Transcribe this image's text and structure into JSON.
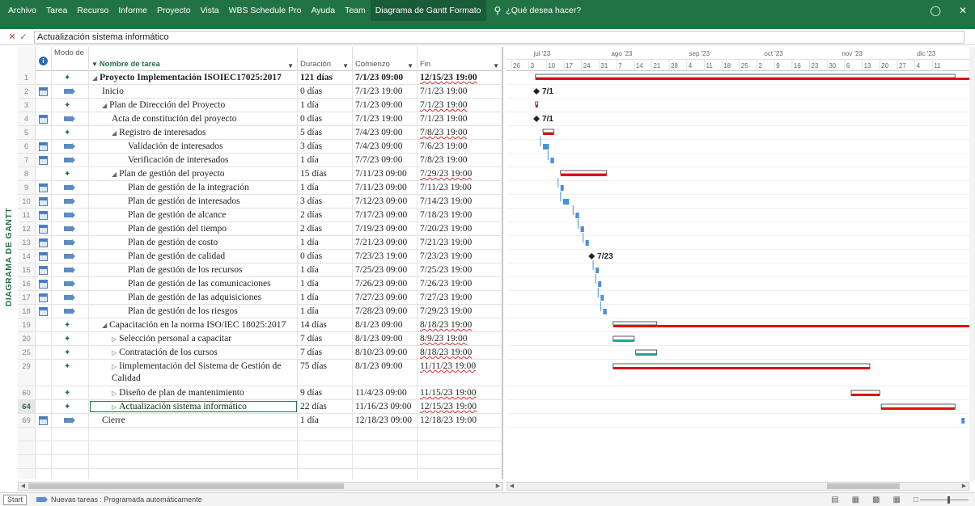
{
  "ribbon": {
    "menu": [
      "Archivo",
      "Tarea",
      "Recurso",
      "Informe",
      "Proyecto",
      "Vista",
      "WBS Schedule Pro",
      "Ayuda",
      "Team",
      "Diagrama de Gantt Formato"
    ],
    "active_index": 9,
    "help": "¿Qué desea hacer?"
  },
  "entry_bar": {
    "value": "Actualización sistema informático"
  },
  "view_label": "DIAGRAMA DE GANTT",
  "columns": {
    "mode": "Modo de",
    "name": "Nombre de tarea",
    "duration": "Duración",
    "start": "Comienzo",
    "finish": "Fin"
  },
  "timeline": {
    "months": [
      "jul '23",
      "ago '23",
      "sep '23",
      "oct '23",
      "nov '23",
      "dic '23"
    ],
    "days": [
      "26",
      "3",
      "10",
      "17",
      "24",
      "31",
      "7",
      "14",
      "21",
      "28",
      "4",
      "11",
      "18",
      "25",
      "2",
      "9",
      "16",
      "23",
      "30",
      "6",
      "13",
      "20",
      "27",
      "4",
      "11"
    ]
  },
  "milestone_labels": [
    "7/1",
    "7/1",
    "7/23"
  ],
  "tasks": [
    {
      "id": "1",
      "mode": "manual",
      "name": "Proyecto Implementación ISOIEC17025:2017",
      "duration": "121 días",
      "start": "7/1/23 09:00",
      "finish": "12/15/23 19:00",
      "summary": true,
      "level": 0,
      "bold": true
    },
    {
      "id": "2",
      "mode": "auto",
      "name": "Inicio",
      "duration": "0 días",
      "start": "7/1/23 19:00",
      "finish": "7/1/23 19:00",
      "level": 1
    },
    {
      "id": "3",
      "mode": "manual",
      "name": "Plan de Dirección del Proyecto",
      "duration": "1 día",
      "start": "7/1/23 09:00",
      "finish": "7/1/23 19:00",
      "summary": true,
      "level": 1
    },
    {
      "id": "4",
      "mode": "auto",
      "name": "Acta de constitución del proyecto",
      "duration": "0 días",
      "start": "7/1/23 19:00",
      "finish": "7/1/23 19:00",
      "level": 2
    },
    {
      "id": "5",
      "mode": "manual",
      "name": "Registro de interesados",
      "duration": "5 días",
      "start": "7/4/23 09:00",
      "finish": "7/8/23 19:00",
      "summary": true,
      "level": 2
    },
    {
      "id": "6",
      "mode": "auto",
      "name": "Validación de interesados",
      "duration": "3 días",
      "start": "7/4/23 09:00",
      "finish": "7/6/23 19:00",
      "level": 3
    },
    {
      "id": "7",
      "mode": "auto",
      "name": "Verificación de interesados",
      "duration": "1 día",
      "start": "7/7/23 09:00",
      "finish": "7/8/23 19:00",
      "level": 3
    },
    {
      "id": "8",
      "mode": "manual",
      "name": "Plan de gestión del proyecto",
      "duration": "15 días",
      "start": "7/11/23 09:00",
      "finish": "7/29/23 19:00",
      "summary": true,
      "level": 2
    },
    {
      "id": "9",
      "mode": "auto",
      "name": "Plan de gestión de la integración",
      "duration": "1 día",
      "start": "7/11/23 09:00",
      "finish": "7/11/23 19:00",
      "level": 3
    },
    {
      "id": "10",
      "mode": "auto",
      "name": "Plan de gestión de interesados",
      "duration": "3 días",
      "start": "7/12/23 09:00",
      "finish": "7/14/23 19:00",
      "level": 3
    },
    {
      "id": "11",
      "mode": "auto",
      "name": "Plan de gestión de alcance",
      "duration": "2 días",
      "start": "7/17/23 09:00",
      "finish": "7/18/23 19:00",
      "level": 3
    },
    {
      "id": "12",
      "mode": "auto",
      "name": "Plan de gestión del tiempo",
      "duration": "2 días",
      "start": "7/19/23 09:00",
      "finish": "7/20/23 19:00",
      "level": 3
    },
    {
      "id": "13",
      "mode": "auto",
      "name": "Plan de gestión de costo",
      "duration": "1 día",
      "start": "7/21/23 09:00",
      "finish": "7/21/23 19:00",
      "level": 3
    },
    {
      "id": "14",
      "mode": "auto",
      "name": "Plan de gestión de calidad",
      "duration": "0 días",
      "start": "7/23/23 19:00",
      "finish": "7/23/23 19:00",
      "level": 3
    },
    {
      "id": "15",
      "mode": "auto",
      "name": "Plan de gestión de los recursos",
      "duration": "1 día",
      "start": "7/25/23 09:00",
      "finish": "7/25/23 19:00",
      "level": 3
    },
    {
      "id": "16",
      "mode": "auto",
      "name": "Plan de gestión de las comunicaciones",
      "duration": "1 día",
      "start": "7/26/23 09:00",
      "finish": "7/26/23 19:00",
      "level": 3
    },
    {
      "id": "17",
      "mode": "auto",
      "name": "Plan de gestión de las adquisiciones",
      "duration": "1 día",
      "start": "7/27/23 09:00",
      "finish": "7/27/23 19:00",
      "level": 3
    },
    {
      "id": "18",
      "mode": "auto",
      "name": "Plan de gestión de los riesgos",
      "duration": "1 día",
      "start": "7/28/23 09:00",
      "finish": "7/29/23 19:00",
      "level": 3
    },
    {
      "id": "19",
      "mode": "manual",
      "name": "Capacitación en la norma ISO/IEC 18025:2017",
      "duration": "14 días",
      "start": "8/1/23 09:00",
      "finish": "8/18/23 19:00",
      "summary": true,
      "level": 1
    },
    {
      "id": "20",
      "mode": "manual",
      "name": "Selección personal a capacitar",
      "duration": "7 días",
      "start": "8/1/23 09:00",
      "finish": "8/9/23 19:00",
      "collapsed": true,
      "level": 2
    },
    {
      "id": "25",
      "mode": "manual",
      "name": "Contratación de los cursos",
      "duration": "7 días",
      "start": "8/10/23 09:00",
      "finish": "8/18/23 19:00",
      "collapsed": true,
      "level": 2
    },
    {
      "id": "29",
      "mode": "manual",
      "name": "Iimplementación del Sistema de Gestión de Calidad",
      "duration": "75 días",
      "start": "8/1/23 09:00",
      "finish": "11/11/23 19:00",
      "collapsed": true,
      "level": 2,
      "tall": true
    },
    {
      "id": "60",
      "mode": "manual",
      "name": "Diseño de plan de mantenimiento",
      "duration": "9 días",
      "start": "11/4/23 09:00",
      "finish": "11/15/23 19:00",
      "collapsed": true,
      "level": 2
    },
    {
      "id": "64",
      "mode": "manual",
      "name": "Actualización sistema informático",
      "duration": "22 días",
      "start": "11/16/23 09:00",
      "finish": "12/15/23 19:00",
      "collapsed": true,
      "level": 2,
      "selected": true
    },
    {
      "id": "69",
      "mode": "auto",
      "name": "Cierre",
      "duration": "1 día",
      "start": "12/18/23 09:00",
      "finish": "12/18/23 19:00",
      "level": 1
    }
  ],
  "status_bar": {
    "start": "Start",
    "new_tasks": "Nuevas tareas : Programada automáticamente"
  },
  "colors": {
    "ribbon": "#217346",
    "critical": "#e01010",
    "task": "#4a90d9",
    "rollup": "#2a9d9d"
  }
}
